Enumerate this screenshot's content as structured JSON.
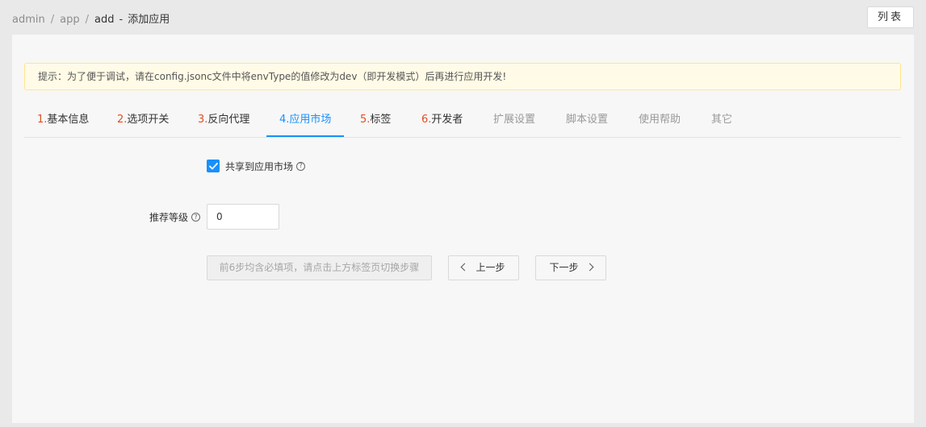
{
  "breadcrumb": {
    "root": "admin",
    "section": "app",
    "current": "add",
    "dash": "-",
    "page_title": "添加应用"
  },
  "header": {
    "list_button": "列表"
  },
  "alert": {
    "text": "提示：为了便于调试，请在config.jsonc文件中将envType的值修改为dev（即开发模式）后再进行应用开发!"
  },
  "tabs": [
    {
      "num": "1.",
      "label": "基本信息"
    },
    {
      "num": "2.",
      "label": "选项开关"
    },
    {
      "num": "3.",
      "label": "反向代理"
    },
    {
      "num": "4.",
      "label": "应用市场"
    },
    {
      "num": "5.",
      "label": "标签"
    },
    {
      "num": "6.",
      "label": "开发者"
    },
    {
      "num": "",
      "label": "扩展设置"
    },
    {
      "num": "",
      "label": "脚本设置"
    },
    {
      "num": "",
      "label": "使用帮助"
    },
    {
      "num": "",
      "label": "其它"
    }
  ],
  "form": {
    "share_label": "共享到应用市场",
    "share_checked": true,
    "level_label": "推荐等级",
    "level_value": "0",
    "help_glyph": "?"
  },
  "actions": {
    "hint_button": "前6步均含必填项，请点击上方标签页切换步骤",
    "prev_button": "上一步",
    "next_button": "下一步"
  },
  "colors": {
    "accent": "#1890ff",
    "step_number": "#e04f24",
    "alert_bg": "#fffbe6",
    "alert_border": "#ffe58f"
  },
  "icons": {
    "checkbox": "check-icon",
    "help": "question-circle-icon",
    "prev": "chevron-left-icon",
    "next": "chevron-right-icon"
  }
}
